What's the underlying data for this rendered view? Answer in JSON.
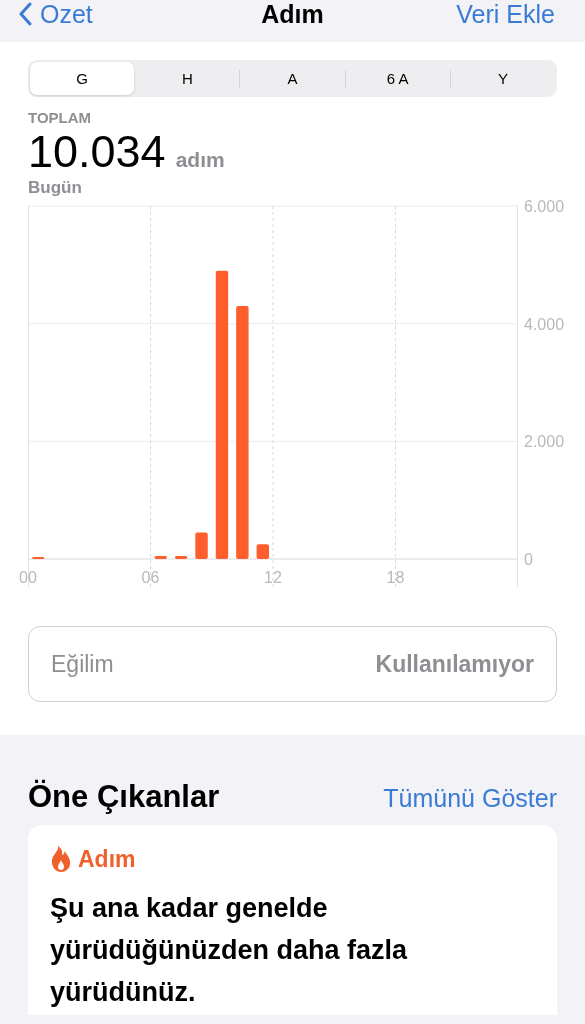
{
  "nav": {
    "back": "Ozet",
    "title": "Adım",
    "action": "Veri Ekle"
  },
  "tabs": [
    {
      "label": "G",
      "selected": true
    },
    {
      "label": "H",
      "selected": false
    },
    {
      "label": "A",
      "selected": false
    },
    {
      "label": "6 A",
      "selected": false
    },
    {
      "label": "Y",
      "selected": false
    }
  ],
  "summary": {
    "label": "TOPLAM",
    "value": "10.034",
    "unit": "adım",
    "period": "Bugün"
  },
  "chart_data": {
    "type": "bar",
    "x": [
      0.5,
      6.5,
      7.5,
      8.5,
      9.5,
      10.5,
      11.5
    ],
    "values": [
      20,
      50,
      50,
      450,
      4900,
      4300,
      250
    ],
    "xlim": [
      0,
      24
    ],
    "grid": true,
    "ylim": [
      0,
      6000
    ],
    "xticks": [
      {
        "value": 0,
        "label": "00"
      },
      {
        "value": 6,
        "label": "06"
      },
      {
        "value": 12,
        "label": "12"
      },
      {
        "value": 18,
        "label": "18"
      }
    ],
    "yticks": [
      {
        "value": 0,
        "label": "0"
      },
      {
        "value": 2000,
        "label": "2.000"
      },
      {
        "value": 4000,
        "label": "4.000"
      },
      {
        "value": 6000,
        "label": "6.000"
      }
    ]
  },
  "trend": {
    "label": "Eğilim",
    "value": "Kullanılamıyor"
  },
  "highlights": {
    "title": "Öne Çıkanlar",
    "link": "Tümünü Göster",
    "card": {
      "category": "Adım",
      "text": "Şu ana kadar genelde yürüdüğünüzden daha fazla yürüdünüz."
    }
  }
}
